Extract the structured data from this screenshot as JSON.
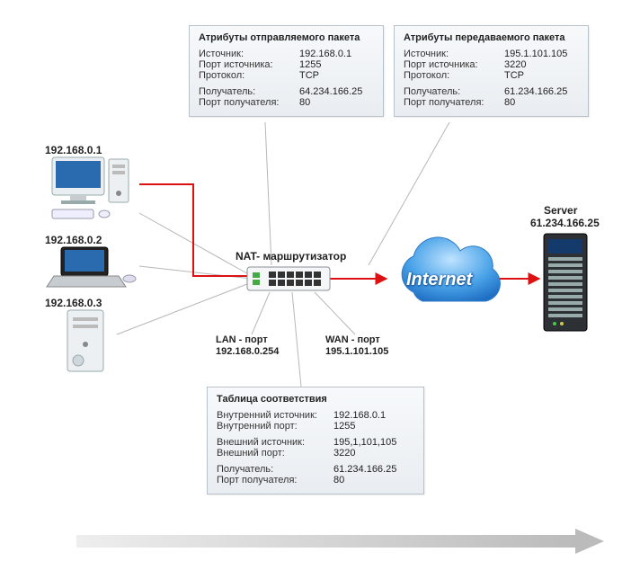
{
  "top_left_box": {
    "title": "Атрибуты отправляемого пакета",
    "src_lbl": "Источник:",
    "src_val": "192.168.0.1",
    "sport_lbl": "Порт источника:",
    "sport_val": "1255",
    "proto_lbl": "Протокол:",
    "proto_val": "TCP",
    "dst_lbl": "Получатель:",
    "dst_val": "64.234.166.25",
    "dport_lbl": "Порт получателя:",
    "dport_val": "80"
  },
  "top_right_box": {
    "title": "Атрибуты передаваемого пакета",
    "src_lbl": "Источник:",
    "src_val": "195.1.101.105",
    "sport_lbl": "Порт источника:",
    "sport_val": "3220",
    "proto_lbl": "Протокол:",
    "proto_val": "TCP",
    "dst_lbl": "Получатель:",
    "dst_val": "61.234.166.25",
    "dport_lbl": "Порт получателя:",
    "dport_val": "80"
  },
  "nat_table": {
    "title": "Таблица соответствия",
    "isrc_lbl": "Внутренний источник:",
    "isrc_val": "192.168.0.1",
    "iport_lbl": "Внутренний порт:",
    "iport_val": "1255",
    "esrc_lbl": "Внешний источник:",
    "esrc_val": "195,1,101,105",
    "eport_lbl": "Внешний порт:",
    "eport_val": "3220",
    "dst_lbl": "Получатель:",
    "dst_val": "61.234.166.25",
    "dport_lbl": "Порт получателя:",
    "dport_val": "80"
  },
  "labels": {
    "pc1": "192.168.0.1",
    "pc2": "192.168.0.2",
    "pc3": "192.168.0.3",
    "nat": "NAT- маршрутизатор",
    "lan1": "LAN - порт",
    "lan2": "192.168.0.254",
    "wan1": "WAN - порт",
    "wan2": "195.1.101.105",
    "server1": "Server",
    "server2": "61.234.166.25",
    "internet": "Internet"
  }
}
